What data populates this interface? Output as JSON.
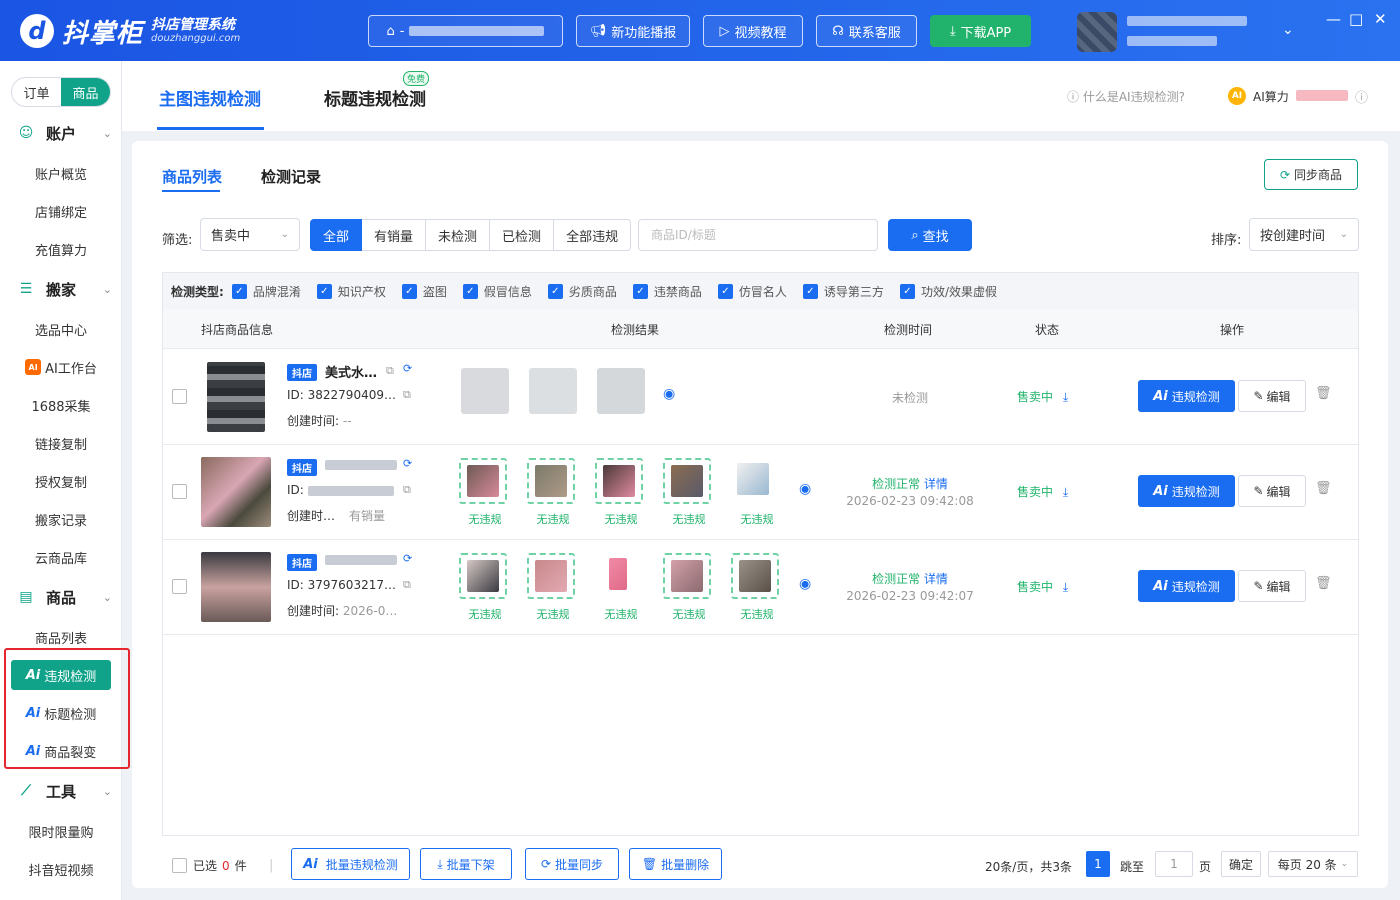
{
  "app": {
    "logo_mark": "d",
    "name": "抖掌柜",
    "subtitle": "抖店管理系统",
    "domain": "douzhanggui.com"
  },
  "topbar": {
    "store_prefix": "-",
    "buttons": [
      {
        "icon": "megaphone-icon",
        "label": "新功能播报"
      },
      {
        "icon": "video-icon",
        "label": "视频教程"
      },
      {
        "icon": "headset-icon",
        "label": "联系客服"
      },
      {
        "icon": "download-icon",
        "label": "下载APP"
      }
    ],
    "window_controls": [
      "—",
      "□",
      "✕"
    ]
  },
  "sidebar": {
    "mode_tabs": [
      {
        "label": "订单",
        "active": false
      },
      {
        "label": "商品",
        "active": true
      }
    ],
    "groups": [
      {
        "label": "账户",
        "icon": "account-icon",
        "items": [
          "账户概览",
          "店铺绑定",
          "充值算力"
        ]
      },
      {
        "label": "搬家",
        "icon": "move-icon",
        "items": [
          "选品中心",
          "AI工作台",
          "1688采集",
          "链接复制",
          "授权复制",
          "搬家记录",
          "云商品库"
        ]
      },
      {
        "label": "商品",
        "icon": "product-icon",
        "items": [
          "商品列表",
          "违规检测",
          "标题检测",
          "商品裂变"
        ]
      },
      {
        "label": "工具",
        "icon": "chart-icon",
        "items": [
          "限时限量购",
          "抖音短视频"
        ]
      }
    ],
    "ai_prefix": "Ai",
    "active_item": "违规检测"
  },
  "main_tabs": [
    {
      "label": "主图违规检测",
      "active": true
    },
    {
      "label": "标题违规检测",
      "active": false,
      "badge": "免费"
    }
  ],
  "help": {
    "what_is": "什么是AI违规检测?",
    "ai_power_label": "AI算力",
    "coin": "AI"
  },
  "content": {
    "tabs": [
      {
        "label": "商品列表",
        "active": true
      },
      {
        "label": "检测记录",
        "active": false
      }
    ],
    "sync_label": "同步商品",
    "filter_label": "筛选:",
    "filter_value": "售卖中",
    "segments": [
      "全部",
      "有销量",
      "未检测",
      "已检测",
      "全部违规"
    ],
    "active_segment": "全部",
    "search_placeholder": "商品ID/标题",
    "find_label": "查找",
    "sort_label": "排序:",
    "sort_value": "按创建时间"
  },
  "detect_types": {
    "label": "检测类型:",
    "items": [
      "品牌混淆",
      "知识产权",
      "盗图",
      "假冒信息",
      "劣质商品",
      "违禁商品",
      "仿冒名人",
      "诱导第三方",
      "功效/效果虚假"
    ]
  },
  "table": {
    "headers": [
      "抖店商品信息",
      "检测结果",
      "检测时间",
      "状态",
      "操作"
    ],
    "rows": [
      {
        "badge": "抖店",
        "title": "美式水…",
        "id": "ID: 3822790409…",
        "created_label": "创建时间:",
        "created_value": "--",
        "sales": "",
        "results": [
          {
            "caption": "",
            "ok": false
          },
          {
            "caption": "",
            "ok": false
          },
          {
            "caption": "",
            "ok": false
          }
        ],
        "detect_status": "未检测",
        "detect_detail": "",
        "time": "",
        "status": "售卖中",
        "ai_label": "违规检测",
        "edit_label": "编辑"
      },
      {
        "badge": "抖店",
        "title": "",
        "id": "ID:",
        "created_label": "创建时…",
        "created_value": "",
        "sales": "有销量",
        "results": [
          {
            "caption": "无违规",
            "ok": true
          },
          {
            "caption": "无违规",
            "ok": true
          },
          {
            "caption": "无违规",
            "ok": true
          },
          {
            "caption": "无违规",
            "ok": true
          },
          {
            "caption": "无违规",
            "ok": true
          }
        ],
        "detect_status": "检测正常",
        "detect_detail": "详情",
        "time": "2026-02-23 09:42:08",
        "status": "售卖中",
        "ai_label": "违规检测",
        "edit_label": "编辑"
      },
      {
        "badge": "抖店",
        "title": "",
        "id": "ID: 3797603217…",
        "created_label": "创建时间:",
        "created_value": "2026-0…",
        "sales": "",
        "results": [
          {
            "caption": "无违规",
            "ok": true
          },
          {
            "caption": "无违规",
            "ok": true
          },
          {
            "caption": "无违规",
            "ok": true
          },
          {
            "caption": "无违规",
            "ok": true
          },
          {
            "caption": "无违规",
            "ok": true
          }
        ],
        "detect_status": "检测正常",
        "detect_detail": "详情",
        "time": "2026-02-23 09:42:07",
        "status": "售卖中",
        "ai_label": "违规检测",
        "edit_label": "编辑"
      }
    ]
  },
  "footer": {
    "selected_label": "已选",
    "selected_count": "0",
    "selected_unit": "件",
    "separator": "|",
    "actions": [
      {
        "icon": "ai-icon",
        "label": "批量违规检测"
      },
      {
        "icon": "download-icon",
        "label": "批量下架"
      },
      {
        "icon": "refresh-icon",
        "label": "批量同步"
      },
      {
        "icon": "trash-icon",
        "label": "批量删除"
      }
    ],
    "pagination": {
      "summary": "20条/页，共3条",
      "current_page": "1",
      "goto_label": "跳至",
      "goto_value": "1",
      "page_unit": "页",
      "confirm": "确定",
      "page_size": "每页 20 条"
    }
  }
}
